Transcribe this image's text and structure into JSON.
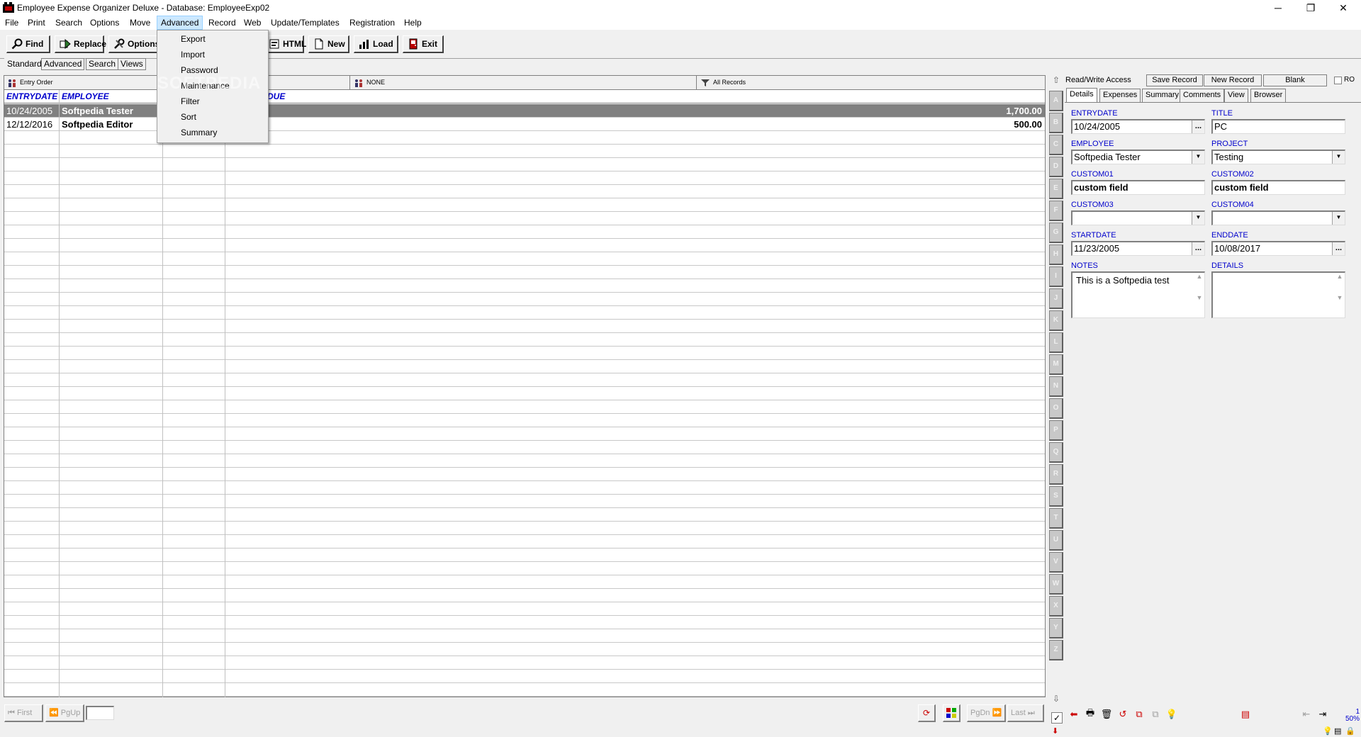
{
  "window": {
    "title": "Employee Expense Organizer Deluxe - Database: EmployeeExp02",
    "controls": {
      "minimize": "─",
      "restore": "❐",
      "close": "✕"
    }
  },
  "menu": [
    "File",
    "Print",
    "Search",
    "Options",
    "Move",
    "Advanced",
    "Record",
    "Web",
    "Update/Templates",
    "Registration",
    "Help"
  ],
  "advanced_menu": [
    "Export",
    "Import",
    "Password",
    "Maintenance",
    "Filter",
    "Sort",
    "Summary"
  ],
  "toolbar": {
    "find": "Find",
    "replace": "Replace",
    "options": "Options",
    "html": "HTML",
    "new": "New",
    "load": "Load",
    "exit": "Exit"
  },
  "mode_tabs": [
    "Standard",
    "Advanced",
    "Search",
    "Views"
  ],
  "grid": {
    "header_bar": {
      "sort": "Entry Order",
      "group": "NONE",
      "filter": "All Records"
    },
    "columns": [
      "ENTRYDATE",
      "EMPLOYEE",
      "DUE"
    ],
    "rows": [
      {
        "entrydate": "10/24/2005",
        "employee": "Softpedia Tester",
        "due": "1,700.00"
      },
      {
        "entrydate": "12/12/2016",
        "employee": "Softpedia Editor",
        "due": "500.00"
      }
    ]
  },
  "watermark": "SOFTPEDIA",
  "alphabet": [
    "A",
    "B",
    "C",
    "D",
    "E",
    "F",
    "G",
    "H",
    "I",
    "J",
    "K",
    "L",
    "M",
    "N",
    "O",
    "P",
    "Q",
    "R",
    "S",
    "T",
    "U",
    "V",
    "W",
    "X",
    "Y",
    "Z"
  ],
  "record_panel": {
    "access": "Read/Write Access",
    "save": "Save Record",
    "new": "New Record",
    "blank": "Blank",
    "ro": "RO",
    "tabs": [
      "Details",
      "Expenses",
      "Summary",
      "Comments",
      "View",
      "Browser"
    ],
    "fields": {
      "entrydate_label": "ENTRYDATE",
      "entrydate": "10/24/2005",
      "title_label": "TITLE",
      "title": "PC",
      "employee_label": "EMPLOYEE",
      "employee": "Softpedia Tester",
      "project_label": "PROJECT",
      "project": "Testing",
      "custom01_label": "CUSTOM01",
      "custom01": "custom field",
      "custom02_label": "CUSTOM02",
      "custom02": "custom field",
      "custom03_label": "CUSTOM03",
      "custom03": "",
      "custom04_label": "CUSTOM04",
      "custom04": "",
      "startdate_label": "STARTDATE",
      "startdate": "11/23/2005",
      "enddate_label": "ENDDATE",
      "enddate": "10/08/2017",
      "notes_label": "NOTES",
      "notes": "This is a Softpedia test",
      "details_label": "DETAILS",
      "details": ""
    }
  },
  "nav": {
    "first": "First",
    "pgup": "PgUp",
    "pgdn": "PgDn",
    "last": "Last"
  },
  "zoom": {
    "page": "1",
    "percent": "50%"
  },
  "ellipsis": "...",
  "dropdown_arrow": "▼",
  "colors": {
    "header_text": "#0000cc",
    "selected_row": "#808080",
    "menu_highlight": "#cce8ff"
  }
}
